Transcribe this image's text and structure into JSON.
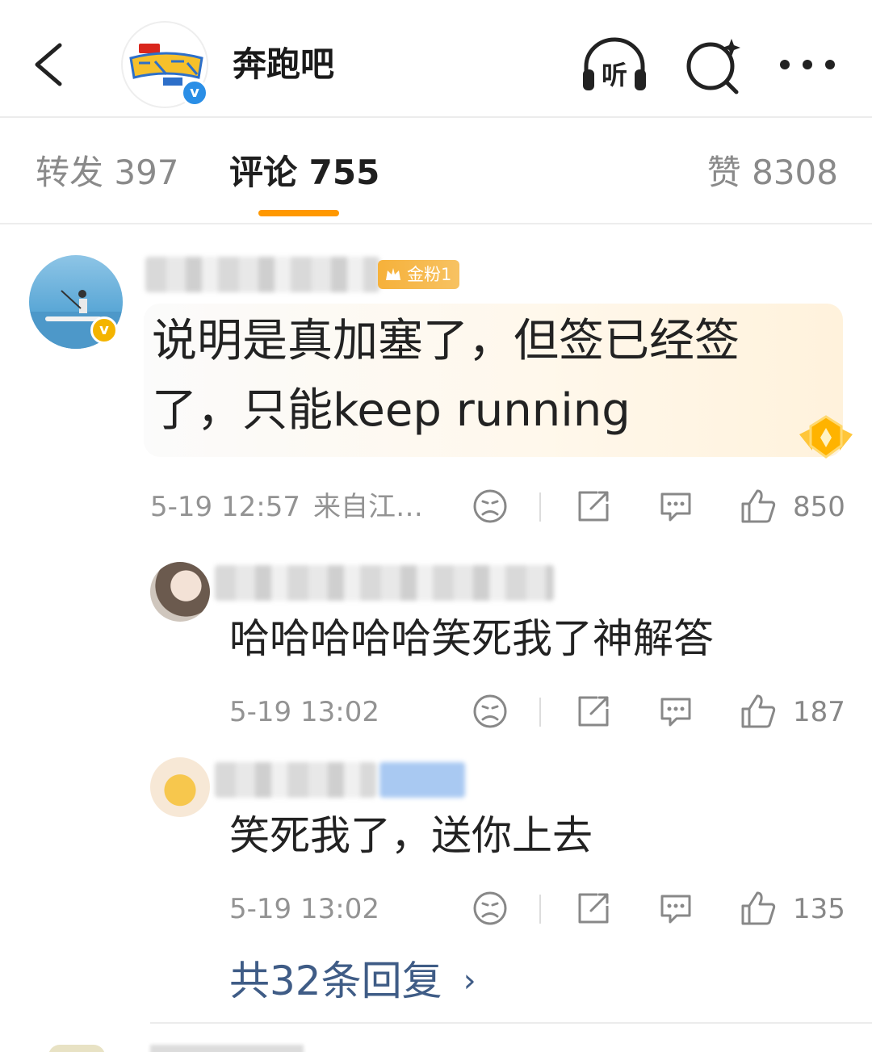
{
  "header": {
    "channel_name": "奔跑吧",
    "listen_label": "听"
  },
  "tabs": [
    {
      "label": "转发 397",
      "active": false
    },
    {
      "label": "评论 755",
      "active": true
    },
    {
      "label": "赞 8308",
      "active": false
    }
  ],
  "comments": [
    {
      "badge": "金粉1",
      "text": "说明是真加塞了，但签已经签了，只能keep running",
      "time": "5-19 12:57",
      "source": "来自江…",
      "likes": "850"
    },
    {
      "text": "哈哈哈哈哈笑死我了神解答",
      "time": "5-19 13:02",
      "likes": "187"
    },
    {
      "text": "笑死我了，送你上去",
      "time": "5-19 13:02",
      "likes": "135"
    }
  ],
  "more_replies": "共32条回复",
  "colors": {
    "accent": "#ff9800",
    "link": "#3f5c86",
    "verify_blue": "#2a8ee6",
    "gold": "#f4b400"
  },
  "icons": [
    "back-arrow-icon",
    "headphones-icon",
    "search-sparkle-icon",
    "more-dots-icon",
    "dislike-face-icon",
    "share-icon",
    "comment-icon",
    "thumbs-up-icon",
    "chevron-right-icon"
  ]
}
